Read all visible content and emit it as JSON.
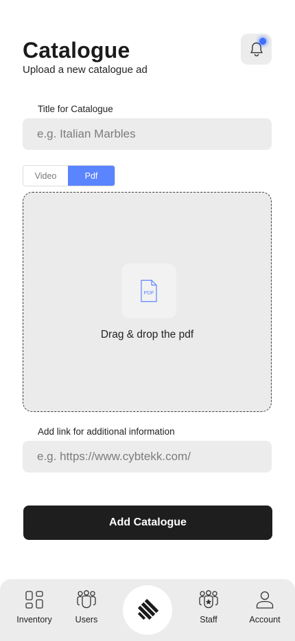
{
  "header": {
    "title": "Catalogue",
    "subtitle": "Upload a new catalogue ad",
    "notification_icon": "bell-icon",
    "notification_dot_color": "#3f70ff"
  },
  "form": {
    "title_label": "Title for Catalogue",
    "title_placeholder": "e.g. Italian Marbles",
    "media_toggle": {
      "options": [
        "Video",
        "Pdf"
      ],
      "selected": "Pdf",
      "active_color": "#5b84ff"
    },
    "dropzone": {
      "icon": "pdf-file-icon",
      "icon_text": "PDF",
      "text": "Drag & drop the pdf"
    },
    "link_label": "Add link for additional information",
    "link_placeholder": "e.g. https://www.cybtekk.com/",
    "submit_label": "Add Catalogue"
  },
  "bottom_nav": {
    "items": [
      {
        "label": "Inventory",
        "icon": "grid-icon"
      },
      {
        "label": "Users",
        "icon": "users-icon"
      },
      {
        "label": "",
        "icon": "logo-icon"
      },
      {
        "label": "Staff",
        "icon": "staff-icon"
      },
      {
        "label": "Account",
        "icon": "account-icon"
      }
    ]
  }
}
